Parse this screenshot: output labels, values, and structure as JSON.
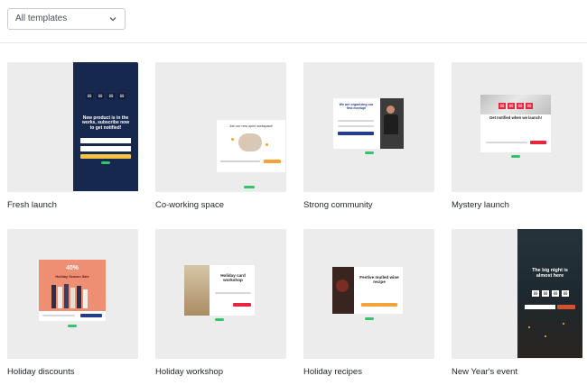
{
  "filter": {
    "selected": "All templates",
    "icon": "chevron-down-icon"
  },
  "templates": [
    {
      "title": "Fresh launch",
      "popup": {
        "digits": [
          "00",
          "00",
          "00",
          "00"
        ],
        "headline": "New product is in the works, subscribe now to get notified!"
      }
    },
    {
      "title": "Co-working space",
      "popup": {
        "headline": "Join our new open workspace!"
      }
    },
    {
      "title": "Strong community",
      "popup": {
        "headline": "We are organizing our first meetup!"
      }
    },
    {
      "title": "Mystery launch",
      "popup": {
        "digits": [
          "00",
          "00",
          "00",
          "00"
        ],
        "headline": "Get notified when we launch!"
      }
    },
    {
      "title": "Holiday discounts",
      "popup": {
        "percent": "40%",
        "headline": "Holiday Season Sale"
      }
    },
    {
      "title": "Holiday workshop",
      "popup": {
        "headline": "Holiday card workshop"
      }
    },
    {
      "title": "Holiday recipes",
      "popup": {
        "headline": "Festive mulled wine recipe"
      }
    },
    {
      "title": "New Year's event",
      "popup": {
        "headline": "The big night is almost here",
        "digits": [
          "00",
          "00",
          "00",
          "00"
        ]
      }
    }
  ],
  "colors": {
    "navy": "#17284f",
    "yellow": "#f5c242",
    "orange": "#f3a33a",
    "red": "#e6263e",
    "salmon": "#ee8e73",
    "green": "#32c36c",
    "dark_blue": "#253b8c",
    "sale_orange": "#d2542e"
  }
}
